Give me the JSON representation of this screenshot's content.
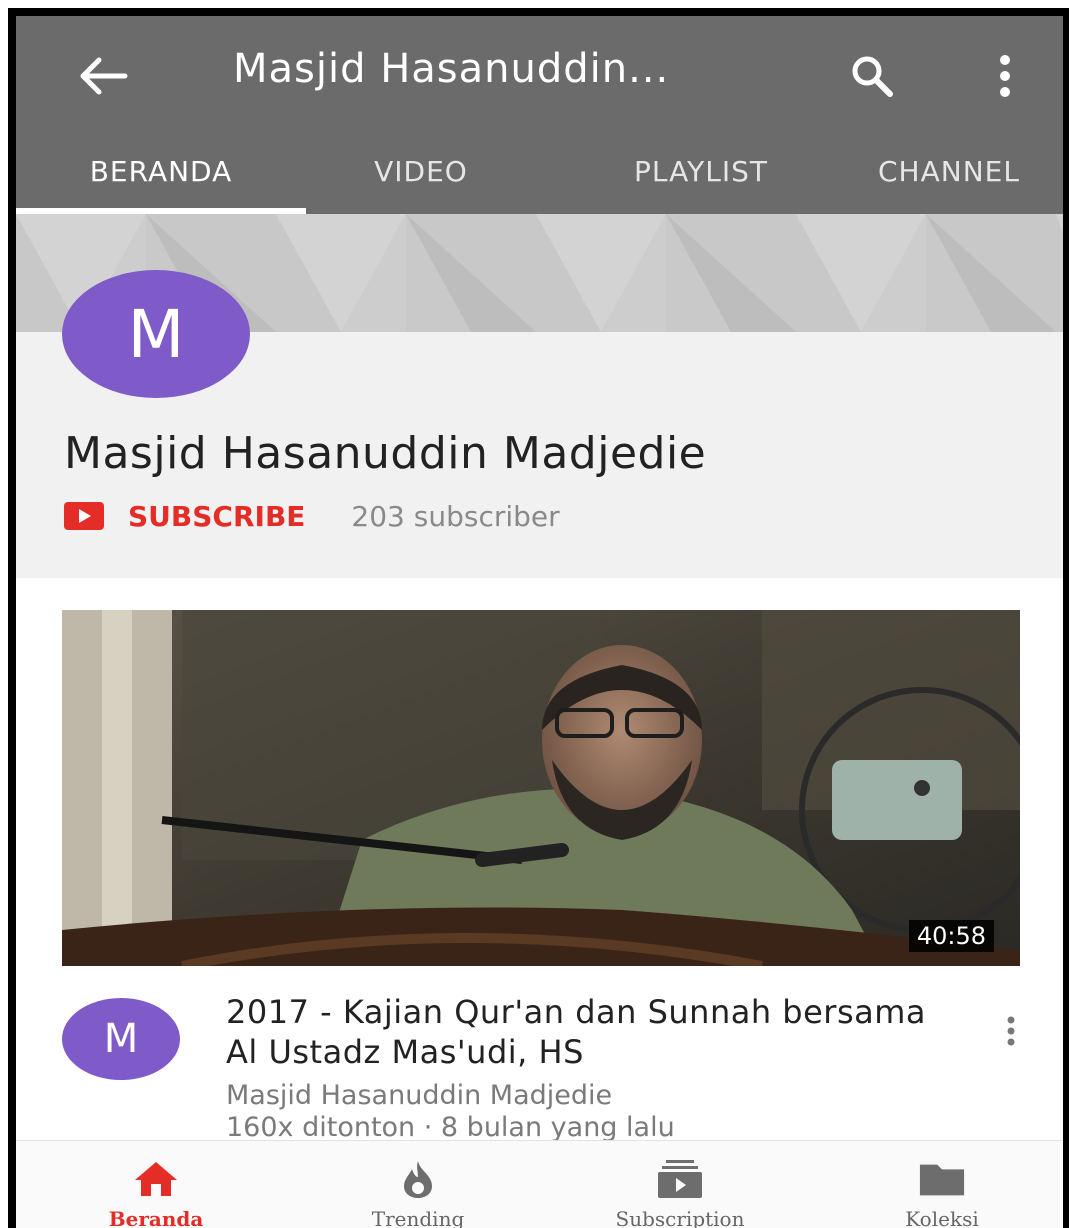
{
  "header": {
    "title": "Masjid Hasanuddin...",
    "tabs": [
      {
        "label": "BERANDA",
        "active": true
      },
      {
        "label": "VIDEO",
        "active": false
      },
      {
        "label": "PLAYLIST",
        "active": false
      },
      {
        "label": "CHANNEL",
        "active": false
      }
    ]
  },
  "channel": {
    "avatar_letter": "M",
    "name": "Masjid Hasanuddin Madjedie",
    "subscribe_label": "SUBSCRIBE",
    "subscriber_count": "203 subscriber"
  },
  "video": {
    "duration": "40:58",
    "avatar_letter": "M",
    "title": "2017 - Kajian Qur'an dan Sunnah bersama  Al Ustadz Mas'udi, HS",
    "channel": "Masjid Hasanuddin Madjedie",
    "stats": "160x ditonton · 8 bulan yang lalu"
  },
  "bottom_nav": [
    {
      "label": "Beranda",
      "icon": "home-icon",
      "active": true
    },
    {
      "label": "Trending",
      "icon": "flame-icon",
      "active": false
    },
    {
      "label": "Subscription",
      "icon": "subscriptions-icon",
      "active": false
    },
    {
      "label": "Koleksi",
      "icon": "folder-icon",
      "active": false
    }
  ],
  "colors": {
    "appbar": "#6b6b6b",
    "accent": "#e52d27",
    "avatar": "#7e5bc9"
  }
}
